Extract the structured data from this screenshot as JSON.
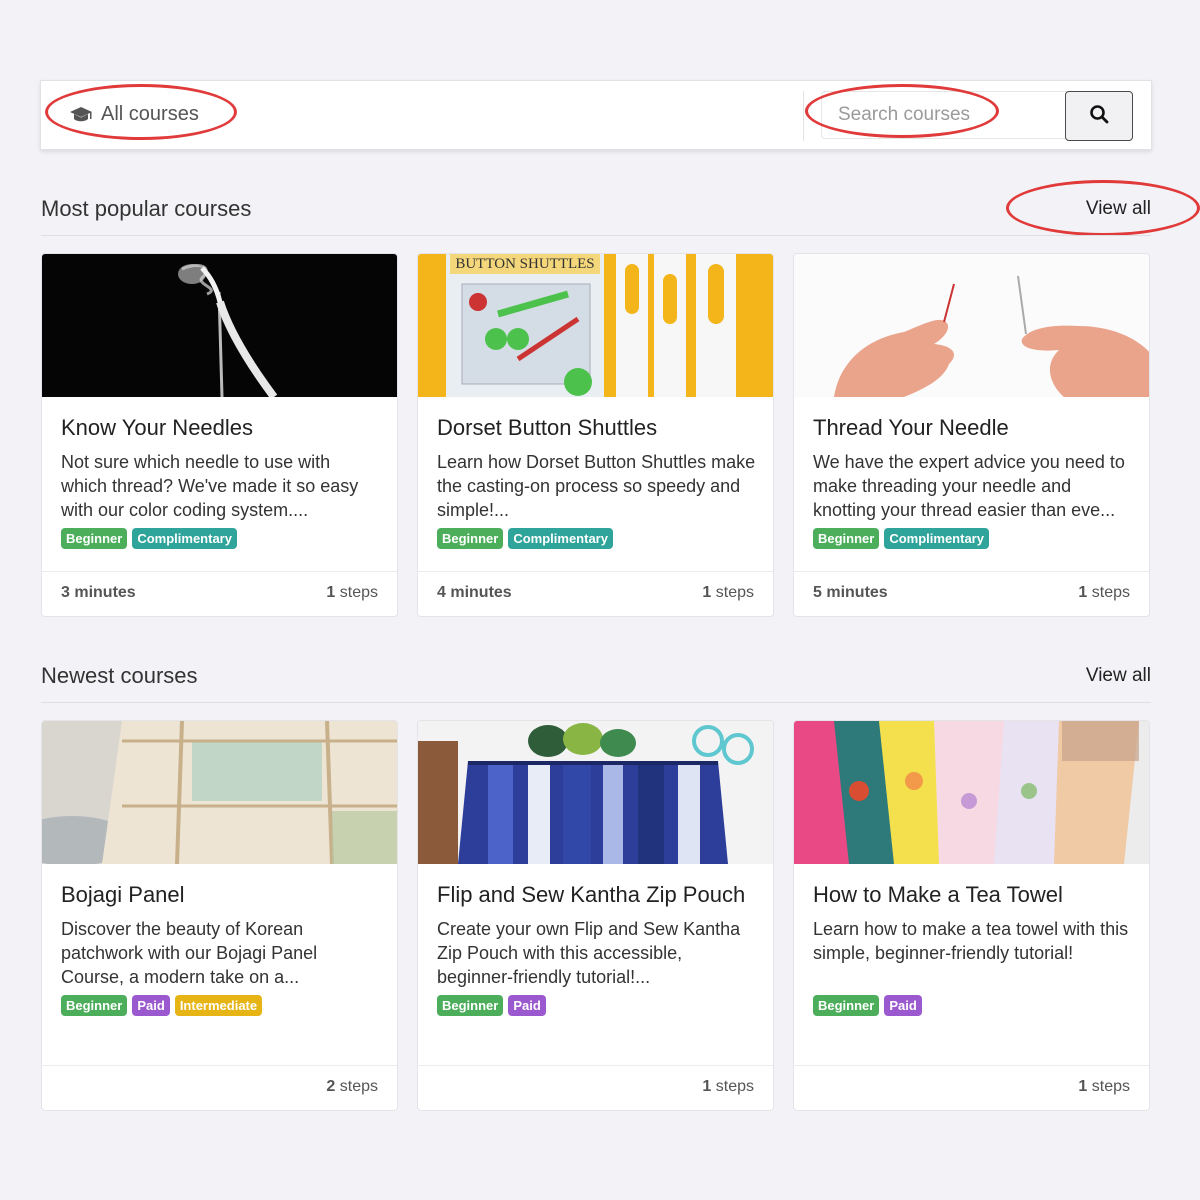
{
  "topbar": {
    "all_courses_label": "All courses",
    "search_placeholder": "Search courses"
  },
  "popular": {
    "title": "Most popular courses",
    "view_all": "View all",
    "courses": [
      {
        "title": "Know Your Needles",
        "description": "Not sure which needle to use with which thread? We've made it so easy with our color coding system....",
        "tags": [
          "Beginner",
          "Complimentary"
        ],
        "duration": "3 minutes",
        "steps_count": "1",
        "steps_label": "steps"
      },
      {
        "title": "Dorset Button Shuttles",
        "description": "Learn how Dorset Button Shuttles make the casting-on process so speedy and simple!...",
        "tags": [
          "Beginner",
          "Complimentary"
        ],
        "duration": "4 minutes",
        "steps_count": "1",
        "steps_label": "steps",
        "thumb_text": "BUTTON SHUTTLES"
      },
      {
        "title": "Thread Your Needle",
        "description": "We have the expert advice you need to make threading your needle and knotting your thread easier than eve...",
        "tags": [
          "Beginner",
          "Complimentary"
        ],
        "duration": "5 minutes",
        "steps_count": "1",
        "steps_label": "steps"
      }
    ]
  },
  "newest": {
    "title": "Newest courses",
    "view_all": "View all",
    "courses": [
      {
        "title": "Bojagi Panel",
        "description": "Discover the beauty of Korean patchwork with our Bojagi Panel Course, a modern take on a...",
        "tags": [
          "Beginner",
          "Paid",
          "Intermediate"
        ],
        "steps_count": "2",
        "steps_label": "steps"
      },
      {
        "title": "Flip and Sew Kantha Zip Pouch",
        "description": "Create your own Flip and Sew Kantha Zip Pouch with this accessible, beginner-friendly tutorial!...",
        "tags": [
          "Beginner",
          "Paid"
        ],
        "steps_count": "1",
        "steps_label": "steps"
      },
      {
        "title": "How to Make a Tea Towel",
        "description": "Learn how to make a tea towel with this simple, beginner-friendly tutorial!",
        "tags": [
          "Beginner",
          "Paid"
        ],
        "steps_count": "1",
        "steps_label": "steps"
      }
    ]
  },
  "colors": {
    "annotation": "#e03a3a",
    "tag_beginner": "#4cae5b",
    "tag_complimentary": "#2fa49a",
    "tag_paid": "#9b59d0",
    "tag_intermediate": "#e7b416"
  },
  "icons": {
    "all_courses": "graduation-cap-icon",
    "search": "search-icon"
  }
}
